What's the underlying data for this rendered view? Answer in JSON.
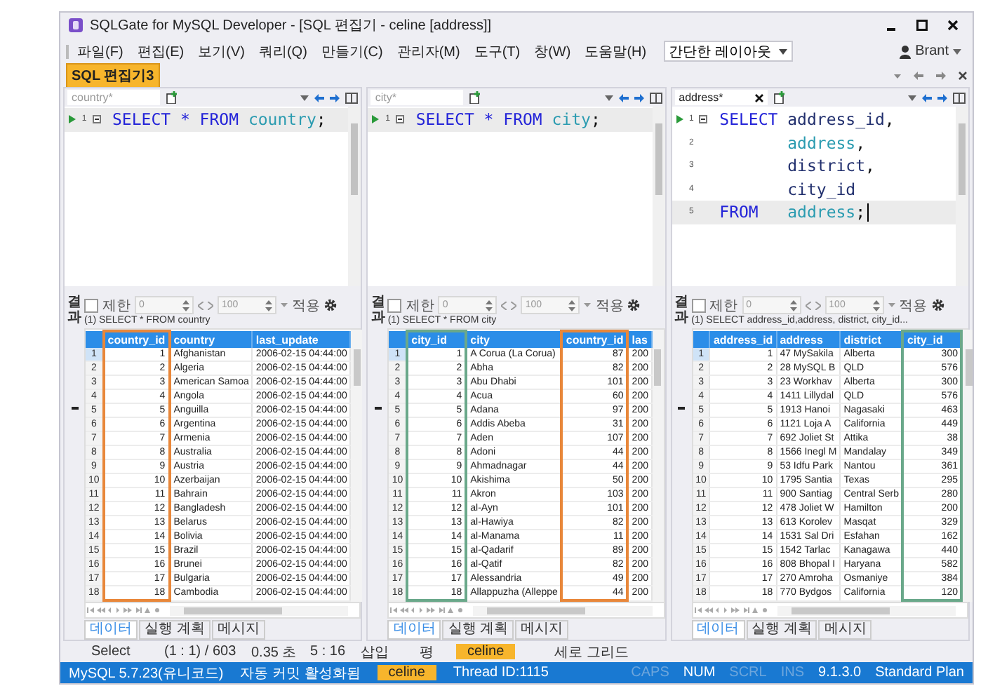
{
  "window": {
    "title": "SQLGate for MySQL Developer - [SQL 편집기 - celine [address]]"
  },
  "menu": [
    "파일(F)",
    "편집(E)",
    "보기(V)",
    "쿼리(Q)",
    "만들기(C)",
    "관리자(M)",
    "도구(T)",
    "창(W)",
    "도움말(H)"
  ],
  "layout_select": {
    "value": "간단한 레이아웃"
  },
  "user": {
    "name": "Brant"
  },
  "doc_tabs": [
    {
      "label": "SQL 편집기3",
      "selected": true
    }
  ],
  "panes": [
    {
      "editor_tab": {
        "label": "country*",
        "selected": false
      },
      "lines": [
        {
          "number": "1",
          "run": true,
          "fold": true,
          "current": true,
          "caret": false,
          "tokens": [
            {
              "text": "SELECT * FROM",
              "kind": "keyword"
            },
            {
              "text": " country",
              "kind": "table"
            },
            {
              "text": ";",
              "kind": "plain"
            }
          ]
        }
      ],
      "results": {
        "side_label": "결과",
        "limit": {
          "label": "제한",
          "checked": false,
          "value": "0"
        },
        "fetch": "100",
        "apply": "적용",
        "caption": "(1) SELECT * FROM country",
        "columns": [
          {
            "name": "country_id",
            "kind": "number",
            "color": "#e8873a"
          },
          {
            "name": "country",
            "kind": "text"
          },
          {
            "name": "last_update",
            "kind": "text"
          }
        ],
        "rows": [
          {
            "number": "1",
            "selected": true,
            "cells": [
              "1",
              "Afghanistan",
              "2006-02-15 04:44:00"
            ]
          },
          {
            "number": "2",
            "selected": false,
            "cells": [
              "2",
              "Algeria",
              "2006-02-15 04:44:00"
            ]
          },
          {
            "number": "3",
            "selected": false,
            "cells": [
              "3",
              "American Samoa",
              "2006-02-15 04:44:00"
            ]
          },
          {
            "number": "4",
            "selected": false,
            "cells": [
              "4",
              "Angola",
              "2006-02-15 04:44:00"
            ]
          },
          {
            "number": "5",
            "selected": false,
            "cells": [
              "5",
              "Anguilla",
              "2006-02-15 04:44:00"
            ]
          },
          {
            "number": "6",
            "selected": false,
            "cells": [
              "6",
              "Argentina",
              "2006-02-15 04:44:00"
            ]
          },
          {
            "number": "7",
            "selected": false,
            "cells": [
              "7",
              "Armenia",
              "2006-02-15 04:44:00"
            ]
          },
          {
            "number": "8",
            "selected": false,
            "cells": [
              "8",
              "Australia",
              "2006-02-15 04:44:00"
            ]
          },
          {
            "number": "9",
            "selected": false,
            "cells": [
              "9",
              "Austria",
              "2006-02-15 04:44:00"
            ]
          },
          {
            "number": "10",
            "selected": false,
            "cells": [
              "10",
              "Azerbaijan",
              "2006-02-15 04:44:00"
            ]
          },
          {
            "number": "11",
            "selected": false,
            "cells": [
              "11",
              "Bahrain",
              "2006-02-15 04:44:00"
            ]
          },
          {
            "number": "12",
            "selected": false,
            "cells": [
              "12",
              "Bangladesh",
              "2006-02-15 04:44:00"
            ]
          },
          {
            "number": "13",
            "selected": false,
            "cells": [
              "13",
              "Belarus",
              "2006-02-15 04:44:00"
            ]
          },
          {
            "number": "14",
            "selected": false,
            "cells": [
              "14",
              "Bolivia",
              "2006-02-15 04:44:00"
            ]
          },
          {
            "number": "15",
            "selected": false,
            "cells": [
              "15",
              "Brazil",
              "2006-02-15 04:44:00"
            ]
          },
          {
            "number": "16",
            "selected": false,
            "cells": [
              "16",
              "Brunei",
              "2006-02-15 04:44:00"
            ]
          },
          {
            "number": "17",
            "selected": false,
            "cells": [
              "17",
              "Bulgaria",
              "2006-02-15 04:44:00"
            ]
          },
          {
            "number": "18",
            "selected": false,
            "cells": [
              "18",
              "Cambodia",
              "2006-02-15 04:44:00"
            ]
          }
        ],
        "tabs": [
          {
            "label": "데이터",
            "selected": true
          },
          {
            "label": "실행 계획",
            "selected": false
          },
          {
            "label": "메시지",
            "selected": false
          }
        ]
      }
    },
    {
      "editor_tab": {
        "label": "city*",
        "selected": false
      },
      "lines": [
        {
          "number": "1",
          "run": true,
          "fold": true,
          "current": true,
          "caret": false,
          "tokens": [
            {
              "text": "SELECT * FROM",
              "kind": "keyword"
            },
            {
              "text": " city",
              "kind": "table"
            },
            {
              "text": ";",
              "kind": "plain"
            }
          ]
        }
      ],
      "results": {
        "side_label": "결과",
        "limit": {
          "label": "제한",
          "checked": false,
          "value": "0"
        },
        "fetch": "100",
        "apply": "적용",
        "caption": "(1) SELECT * FROM city",
        "columns": [
          {
            "name": "city_id",
            "kind": "number",
            "color": "#6aa88a"
          },
          {
            "name": "city",
            "kind": "text"
          },
          {
            "name": "country_id",
            "kind": "number",
            "color": "#e8873a"
          },
          {
            "name": "las",
            "kind": "text"
          }
        ],
        "rows": [
          {
            "number": "1",
            "selected": true,
            "cells": [
              "1",
              "A Corua (La Corua)",
              "87",
              "200"
            ]
          },
          {
            "number": "2",
            "selected": false,
            "cells": [
              "2",
              "Abha",
              "82",
              "200"
            ]
          },
          {
            "number": "3",
            "selected": false,
            "cells": [
              "3",
              "Abu Dhabi",
              "101",
              "200"
            ]
          },
          {
            "number": "4",
            "selected": false,
            "cells": [
              "4",
              "Acua",
              "60",
              "200"
            ]
          },
          {
            "number": "5",
            "selected": false,
            "cells": [
              "5",
              "Adana",
              "97",
              "200"
            ]
          },
          {
            "number": "6",
            "selected": false,
            "cells": [
              "6",
              "Addis Abeba",
              "31",
              "200"
            ]
          },
          {
            "number": "7",
            "selected": false,
            "cells": [
              "7",
              "Aden",
              "107",
              "200"
            ]
          },
          {
            "number": "8",
            "selected": false,
            "cells": [
              "8",
              "Adoni",
              "44",
              "200"
            ]
          },
          {
            "number": "9",
            "selected": false,
            "cells": [
              "9",
              "Ahmadnagar",
              "44",
              "200"
            ]
          },
          {
            "number": "10",
            "selected": false,
            "cells": [
              "10",
              "Akishima",
              "50",
              "200"
            ]
          },
          {
            "number": "11",
            "selected": false,
            "cells": [
              "11",
              "Akron",
              "103",
              "200"
            ]
          },
          {
            "number": "12",
            "selected": false,
            "cells": [
              "12",
              "al-Ayn",
              "101",
              "200"
            ]
          },
          {
            "number": "13",
            "selected": false,
            "cells": [
              "13",
              "al-Hawiya",
              "82",
              "200"
            ]
          },
          {
            "number": "14",
            "selected": false,
            "cells": [
              "14",
              "al-Manama",
              "11",
              "200"
            ]
          },
          {
            "number": "15",
            "selected": false,
            "cells": [
              "15",
              "al-Qadarif",
              "89",
              "200"
            ]
          },
          {
            "number": "16",
            "selected": false,
            "cells": [
              "16",
              "al-Qatif",
              "82",
              "200"
            ]
          },
          {
            "number": "17",
            "selected": false,
            "cells": [
              "17",
              "Alessandria",
              "49",
              "200"
            ]
          },
          {
            "number": "18",
            "selected": false,
            "cells": [
              "18",
              "Allappuzha (Alleppe",
              "44",
              "200"
            ]
          }
        ],
        "tabs": [
          {
            "label": "데이터",
            "selected": true
          },
          {
            "label": "실행 계획",
            "selected": false
          },
          {
            "label": "메시지",
            "selected": false
          }
        ]
      }
    },
    {
      "editor_tab": {
        "label": "address*",
        "selected": true
      },
      "lines": [
        {
          "number": "1",
          "run": true,
          "fold": true,
          "current": false,
          "caret": false,
          "tokens": [
            {
              "text": "SELECT",
              "kind": "keyword"
            },
            {
              "text": " address_id",
              "kind": "column"
            },
            {
              "text": ",",
              "kind": "plain"
            }
          ]
        },
        {
          "number": "2",
          "run": false,
          "fold": false,
          "current": false,
          "caret": false,
          "tokens": [
            {
              "text": "       address",
              "kind": "table"
            },
            {
              "text": ",",
              "kind": "plain"
            }
          ]
        },
        {
          "number": "3",
          "run": false,
          "fold": false,
          "current": false,
          "caret": false,
          "tokens": [
            {
              "text": "       district",
              "kind": "column"
            },
            {
              "text": ",",
              "kind": "plain"
            }
          ]
        },
        {
          "number": "4",
          "run": false,
          "fold": false,
          "current": false,
          "caret": false,
          "tokens": [
            {
              "text": "       city_id",
              "kind": "column"
            }
          ]
        },
        {
          "number": "5",
          "run": false,
          "fold": false,
          "current": true,
          "caret": true,
          "tokens": [
            {
              "text": "FROM",
              "kind": "keyword"
            },
            {
              "text": "   address",
              "kind": "table"
            },
            {
              "text": ";",
              "kind": "plain"
            }
          ]
        }
      ],
      "results": {
        "side_label": "결과",
        "limit": {
          "label": "제한",
          "checked": false,
          "value": "0"
        },
        "fetch": "100",
        "apply": "적용",
        "caption": "(1) SELECT address_id,address, district, city_id...",
        "columns": [
          {
            "name": "address_id",
            "kind": "number"
          },
          {
            "name": "address",
            "kind": "text"
          },
          {
            "name": "district",
            "kind": "text"
          },
          {
            "name": "city_id",
            "kind": "number",
            "color": "#6aa88a"
          }
        ],
        "rows": [
          {
            "number": "1",
            "selected": true,
            "cells": [
              "1",
              "47 MySakila",
              "Alberta",
              "300"
            ]
          },
          {
            "number": "2",
            "selected": false,
            "cells": [
              "2",
              "28 MySQL B",
              "QLD",
              "576"
            ]
          },
          {
            "number": "3",
            "selected": false,
            "cells": [
              "3",
              "23 Workhav",
              "Alberta",
              "300"
            ]
          },
          {
            "number": "4",
            "selected": false,
            "cells": [
              "4",
              "1411 Lillydal",
              "QLD",
              "576"
            ]
          },
          {
            "number": "5",
            "selected": false,
            "cells": [
              "5",
              "1913 Hanoi",
              "Nagasaki",
              "463"
            ]
          },
          {
            "number": "6",
            "selected": false,
            "cells": [
              "6",
              "1121 Loja A",
              "California",
              "449"
            ]
          },
          {
            "number": "7",
            "selected": false,
            "cells": [
              "7",
              "692 Joliet St",
              "Attika",
              "38"
            ]
          },
          {
            "number": "8",
            "selected": false,
            "cells": [
              "8",
              "1566 Inegl M",
              "Mandalay",
              "349"
            ]
          },
          {
            "number": "9",
            "selected": false,
            "cells": [
              "9",
              "53 Idfu Park",
              "Nantou",
              "361"
            ]
          },
          {
            "number": "10",
            "selected": false,
            "cells": [
              "10",
              "1795 Santia",
              "Texas",
              "295"
            ]
          },
          {
            "number": "11",
            "selected": false,
            "cells": [
              "11",
              "900 Santiag",
              "Central Serb",
              "280"
            ]
          },
          {
            "number": "12",
            "selected": false,
            "cells": [
              "12",
              "478 Joliet W",
              "Hamilton",
              "200"
            ]
          },
          {
            "number": "13",
            "selected": false,
            "cells": [
              "13",
              "613 Korolev",
              "Masqat",
              "329"
            ]
          },
          {
            "number": "14",
            "selected": false,
            "cells": [
              "14",
              "1531 Sal Dri",
              "Esfahan",
              "162"
            ]
          },
          {
            "number": "15",
            "selected": false,
            "cells": [
              "15",
              "1542 Tarlac",
              "Kanagawa",
              "440"
            ]
          },
          {
            "number": "16",
            "selected": false,
            "cells": [
              "16",
              "808 Bhopal I",
              "Haryana",
              "582"
            ]
          },
          {
            "number": "17",
            "selected": false,
            "cells": [
              "17",
              "270 Amroha",
              "Osmaniye",
              "384"
            ]
          },
          {
            "number": "18",
            "selected": false,
            "cells": [
              "18",
              "770 Bydgos",
              "California",
              "120"
            ]
          }
        ],
        "tabs": [
          {
            "label": "데이터",
            "selected": true
          },
          {
            "label": "실행 계획",
            "selected": false
          },
          {
            "label": "메시지",
            "selected": false
          }
        ]
      }
    }
  ],
  "status_line": [
    {
      "text": "Select",
      "kind": "text"
    },
    {
      "text": "(1 : 1) / 603",
      "kind": "text"
    },
    {
      "text": "0.35 초",
      "kind": "text"
    },
    {
      "text": "5 : 16",
      "kind": "text"
    },
    {
      "text": "삽입",
      "kind": "text"
    },
    {
      "text": "평",
      "kind": "text"
    },
    {
      "text": "celine",
      "kind": "badge"
    },
    {
      "text": "세로 그리드",
      "kind": "text"
    }
  ],
  "status_bar": {
    "left": [
      {
        "text": "MySQL 5.7.23(유니코드)",
        "kind": "text"
      },
      {
        "text": "자동 커밋 활성화됨",
        "kind": "text"
      },
      {
        "text": "celine",
        "kind": "badge"
      },
      {
        "text": "Thread ID:1115",
        "kind": "text"
      }
    ],
    "right": [
      {
        "text": "CAPS",
        "kind": "indicator",
        "on": false
      },
      {
        "text": "NUM",
        "kind": "indicator",
        "on": true
      },
      {
        "text": "SCRL",
        "kind": "indicator",
        "on": false
      },
      {
        "text": "INS",
        "kind": "indicator",
        "on": false
      },
      {
        "text": "9.1.3.0",
        "kind": "text"
      },
      {
        "text": "Standard Plan",
        "kind": "text"
      }
    ]
  }
}
